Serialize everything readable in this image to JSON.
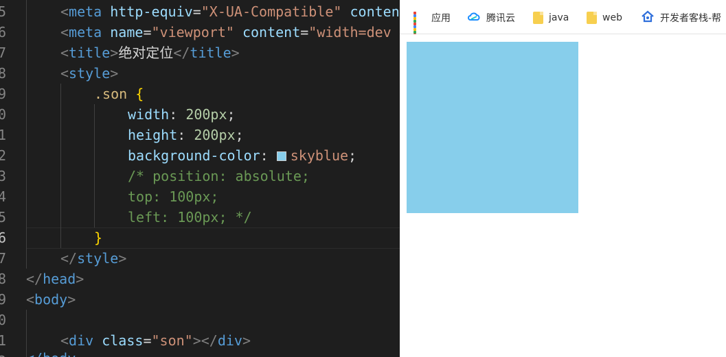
{
  "editor": {
    "line_numbers": [
      "5",
      "6",
      "7",
      "8",
      "9",
      "0",
      "1",
      "2",
      "3",
      "4",
      "5",
      "6",
      "7",
      "8",
      "9",
      "0",
      "1",
      "2"
    ],
    "lines": {
      "meta_compat": [
        "<",
        "meta",
        " ",
        "http-equiv",
        "=",
        "\"X-UA-Compatible\"",
        " ",
        "content"
      ],
      "meta_viewport": [
        "<",
        "meta",
        " ",
        "name",
        "=",
        "\"viewport\"",
        " ",
        "content",
        "=",
        "\"width=dev"
      ],
      "title": [
        "<",
        "title",
        ">",
        "绝对定位",
        "</",
        "title",
        ">"
      ],
      "style_open": [
        "<",
        "style",
        ">"
      ],
      "selector": [
        ".son",
        " ",
        "{"
      ],
      "width": [
        "width",
        ": ",
        "200px",
        ";"
      ],
      "height": [
        "height",
        ": ",
        "200px",
        ";"
      ],
      "bg": [
        "background-color",
        ": ",
        "skyblue",
        ";"
      ],
      "c_position": "/* position: absolute;",
      "c_top": "top: 100px;",
      "c_left": "left: 100px; */",
      "close_brace": "}",
      "style_close": [
        "</",
        "style",
        ">"
      ],
      "head_close": [
        "</",
        "head",
        ">"
      ],
      "body_open": [
        "<",
        "body",
        ">"
      ],
      "div": [
        "<",
        "div",
        " ",
        "class",
        "=",
        "\"son\"",
        "></",
        "div",
        ">"
      ],
      "body_close_partial": "</body"
    }
  },
  "browser": {
    "bookmarks": [
      {
        "label": "应用",
        "icon": "apps-grid-icon"
      },
      {
        "label": "腾讯云",
        "icon": "tencent-cloud-icon"
      },
      {
        "label": "java",
        "icon": "folder-icon"
      },
      {
        "label": "web",
        "icon": "folder-icon"
      },
      {
        "label": "开发者客栈-帮",
        "icon": "home-icon"
      }
    ],
    "son_color": "#87ceeb"
  },
  "colors": {
    "editor_bg": "#1e1e1e",
    "tag": "#569cd6",
    "attribute": "#9cdcfe",
    "string": "#ce9178",
    "selector": "#d7ba7d",
    "brace": "#ffd700",
    "number": "#b5cea8",
    "comment": "#6a9955",
    "swatch": "#87ceeb"
  }
}
